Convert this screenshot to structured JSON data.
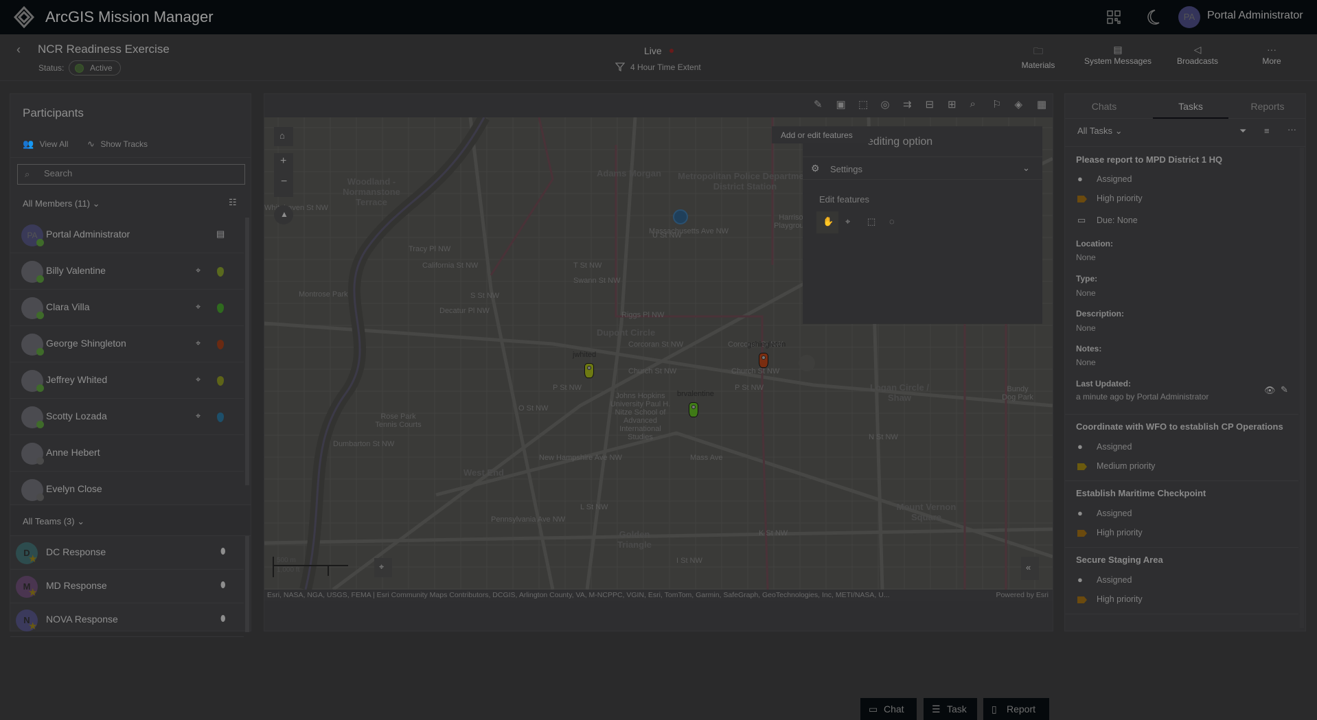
{
  "app": {
    "title": "ArcGIS Mission Manager",
    "user_initials": "PA",
    "user_name": "Portal Administrator",
    "icons": [
      "qr-code-icon",
      "moon-icon"
    ]
  },
  "mission": {
    "title": "NCR Readiness Exercise",
    "status_label": "Status:",
    "status": "Active",
    "live": "Live",
    "time_extent": "4 Hour Time Extent"
  },
  "header_actions": [
    {
      "label": "Materials",
      "icon": "folder-icon"
    },
    {
      "label": "System Messages",
      "icon": "system-message-icon"
    },
    {
      "label": "Broadcasts",
      "icon": "megaphone-icon"
    },
    {
      "label": "More",
      "icon": "ellipsis-icon"
    }
  ],
  "participants": {
    "title": "Participants",
    "view_all": "View All",
    "show_tracks": "Show Tracks",
    "search_placeholder": "Search",
    "members_header": "All Members (11)",
    "members": [
      {
        "name": "Portal Administrator",
        "initials": "PA",
        "online": true,
        "color": ""
      },
      {
        "name": "Billy Valentine",
        "online": true,
        "color": "#5a6a1e"
      },
      {
        "name": "Clara Villa",
        "online": true,
        "color": "#2f6a1e"
      },
      {
        "name": "George Shingleton",
        "online": true,
        "color": "#6a2a12"
      },
      {
        "name": "Jeffrey Whited",
        "online": true,
        "color": "#5e6418"
      },
      {
        "name": "Scotty Lozada",
        "online": true,
        "color": "#1d4f6a"
      },
      {
        "name": "Anne Hebert",
        "online": false,
        "color": ""
      },
      {
        "name": "Evelyn Close",
        "online": false,
        "color": ""
      }
    ],
    "teams_header": "All Teams (3)",
    "teams": [
      {
        "name": "DC Response",
        "initial": "D",
        "color": "#2d4c4e"
      },
      {
        "name": "MD Response",
        "initial": "M",
        "color": "#4a3550"
      },
      {
        "name": "NOVA Response",
        "initial": "N",
        "color": "#3b3a5c"
      }
    ]
  },
  "map": {
    "tooltip": "Add or edit features",
    "editor": {
      "title": "editing option",
      "settings": "Settings",
      "edit_features": "Edit features"
    },
    "labels": {
      "woodland": "Woodland - Normanstone Terrace",
      "adams": "Adams Morgan",
      "mpd": "Metropolitan Police Department District Station",
      "dupont": "Dupont Circle",
      "logan": "Logan Circle / Shaw",
      "westend": "West End",
      "golden": "Golden Triangle",
      "mtvernon": "Mount Vernon Square",
      "rosepark": "Rose Park Tennis Courts",
      "montrose": "Montrose Park",
      "jhu": "Johns Hopkins University Paul H. Nitze School of Advanced International Studies",
      "corcoran": "Corcoran St NW",
      "corcoran2": "Corcoran St NW",
      "church": "Church St NW",
      "church2": "Church St NW",
      "pst": "P St NW",
      "pst2": "P St NW",
      "ost": "O St NW",
      "nst": "N St NW",
      "lst": "L St NW",
      "kst": "K St NW",
      "ist": "I St NW",
      "ust": "U St NW",
      "tst": "T St NW",
      "swann": "Swann St NW",
      "sst": "S St NW",
      "riggs": "Riggs Pl NW",
      "decatur": "Decatur Pl NW",
      "california": "California St NW",
      "tracy": "Tracy Pl NW",
      "whitehaven": "Whitehaven St NW",
      "mass": "Massachusetts Ave NW",
      "massave": "Mass Ave",
      "penn": "Pennsylvania Ave NW",
      "newhamp": "New Hampshire Ave NW",
      "dumbarton": "Dumbarton St NW",
      "harrison": "Harrison Playground",
      "bundy": "Bundy Dog Park"
    },
    "markers": [
      {
        "label": "jwhited",
        "color": "#6e7a12"
      },
      {
        "label": "brvalentine",
        "color": "#3f7a16"
      },
      {
        "label": "gshingleton",
        "color": "#7a2d10"
      }
    ],
    "scale_m": "500 m",
    "scale_ft": "1,000 ft",
    "attribution": "Esri, NASA, NGA, USGS, FEMA | Esri Community Maps Contributors, DCGIS, Arlington County, VA, M-NCPPC, VGIN, Esri, TomTom, Garmin, SafeGraph, GeoTechnologies, Inc, METI/NASA, U...",
    "powered": "Powered by Esri"
  },
  "actions": {
    "chat": "Chat",
    "task": "Task",
    "report": "Report"
  },
  "right": {
    "tabs": [
      "Chats",
      "Tasks",
      "Reports"
    ],
    "active_tab": "Tasks",
    "filter": "All Tasks",
    "task1": {
      "title": "Please report to MPD District 1 HQ",
      "status": "Assigned",
      "priority": "High priority",
      "due": "Due: None",
      "location_l": "Location:",
      "location": "None",
      "type_l": "Type:",
      "type": "None",
      "desc_l": "Description:",
      "desc": "None",
      "notes_l": "Notes:",
      "notes": "None",
      "updated_l": "Last Updated:",
      "updated": "a minute ago by Portal Administrator"
    },
    "tasks": [
      {
        "title": "Coordinate with WFO to establish CP Operations",
        "status": "Assigned",
        "priority": "Medium priority"
      },
      {
        "title": "Establish Maritime Checkpoint",
        "status": "Assigned",
        "priority": "High priority"
      },
      {
        "title": "Secure Staging Area",
        "status": "Assigned",
        "priority": "High priority"
      }
    ],
    "priority_colors": {
      "high": "#6b4a0e",
      "medium": "#6b5a0e"
    }
  }
}
